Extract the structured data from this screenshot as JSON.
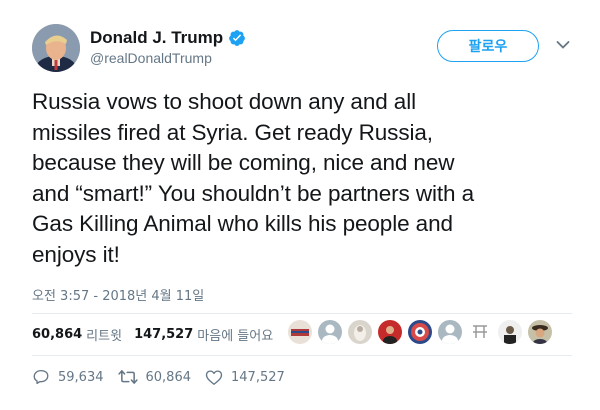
{
  "user": {
    "name": "Donald J. Trump",
    "handle": "@realDonaldTrump"
  },
  "follow_label": "팔로우",
  "tweet": {
    "text": "Russia vows to shoot down any and all\nmissiles fired at Syria. Get ready Russia,\nbecause they will be coming, nice and new\nand “smart!” You shouldn’t be partners with a\nGas Killing Animal who kills his people and\nenjoys it!",
    "timestamp": "오전 3:57 - 2018년 4월 11일"
  },
  "stats": {
    "retweets": "60,864",
    "retweets_label": "리트윗",
    "likes": "147,527",
    "likes_label": "마음에 들어요"
  },
  "actions": {
    "replies": "59,634",
    "retweets": "60,864",
    "likes": "147,527"
  },
  "colors": {
    "accent": "#1da1f2",
    "text": "#14171a",
    "muted": "#657786"
  }
}
